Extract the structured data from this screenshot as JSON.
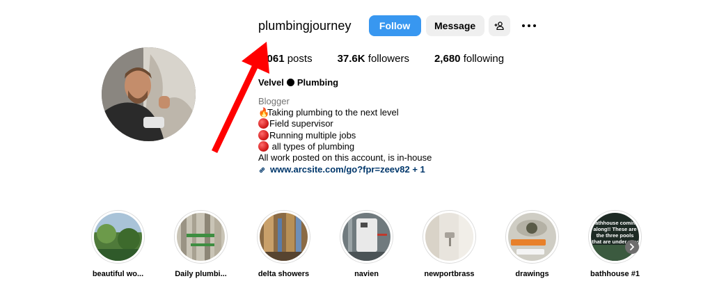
{
  "profile": {
    "username": "plumbingjourney",
    "follow_label": "Follow",
    "message_label": "Message",
    "full_name_left": "Velvel",
    "full_name_right": "Plumbing"
  },
  "stats": {
    "posts_count": "1,061",
    "posts_label": "posts",
    "followers_count": "37.6K",
    "followers_label": "followers",
    "following_count": "2,680",
    "following_label": "following"
  },
  "bio": {
    "category": "Blogger",
    "line1": "Taking plumbing to the next level",
    "line2": "Field supervisor",
    "line3": "Running multiple jobs",
    "line4": " all types of plumbing",
    "line5": "All work posted on this account, is in-house",
    "link": "www.arcsite.com/go?fpr=zeev82 + 1"
  },
  "highlights": [
    {
      "label": "beautiful wo..."
    },
    {
      "label": "Daily plumbi..."
    },
    {
      "label": "delta showers"
    },
    {
      "label": "navien"
    },
    {
      "label": "newportbrass"
    },
    {
      "label": "drawings"
    },
    {
      "label": "bathhouse #1",
      "overlay": "Bathhouse coming along!! These are the three pools that are under way"
    }
  ],
  "colors": {
    "follow_blue": "#3897f0",
    "link_blue": "#00376b",
    "annotation_red": "#ff0000"
  },
  "icons": {
    "suggest": "add-person-icon",
    "more": "more-options-icon",
    "link": "link-icon",
    "next": "chevron-right-icon"
  }
}
